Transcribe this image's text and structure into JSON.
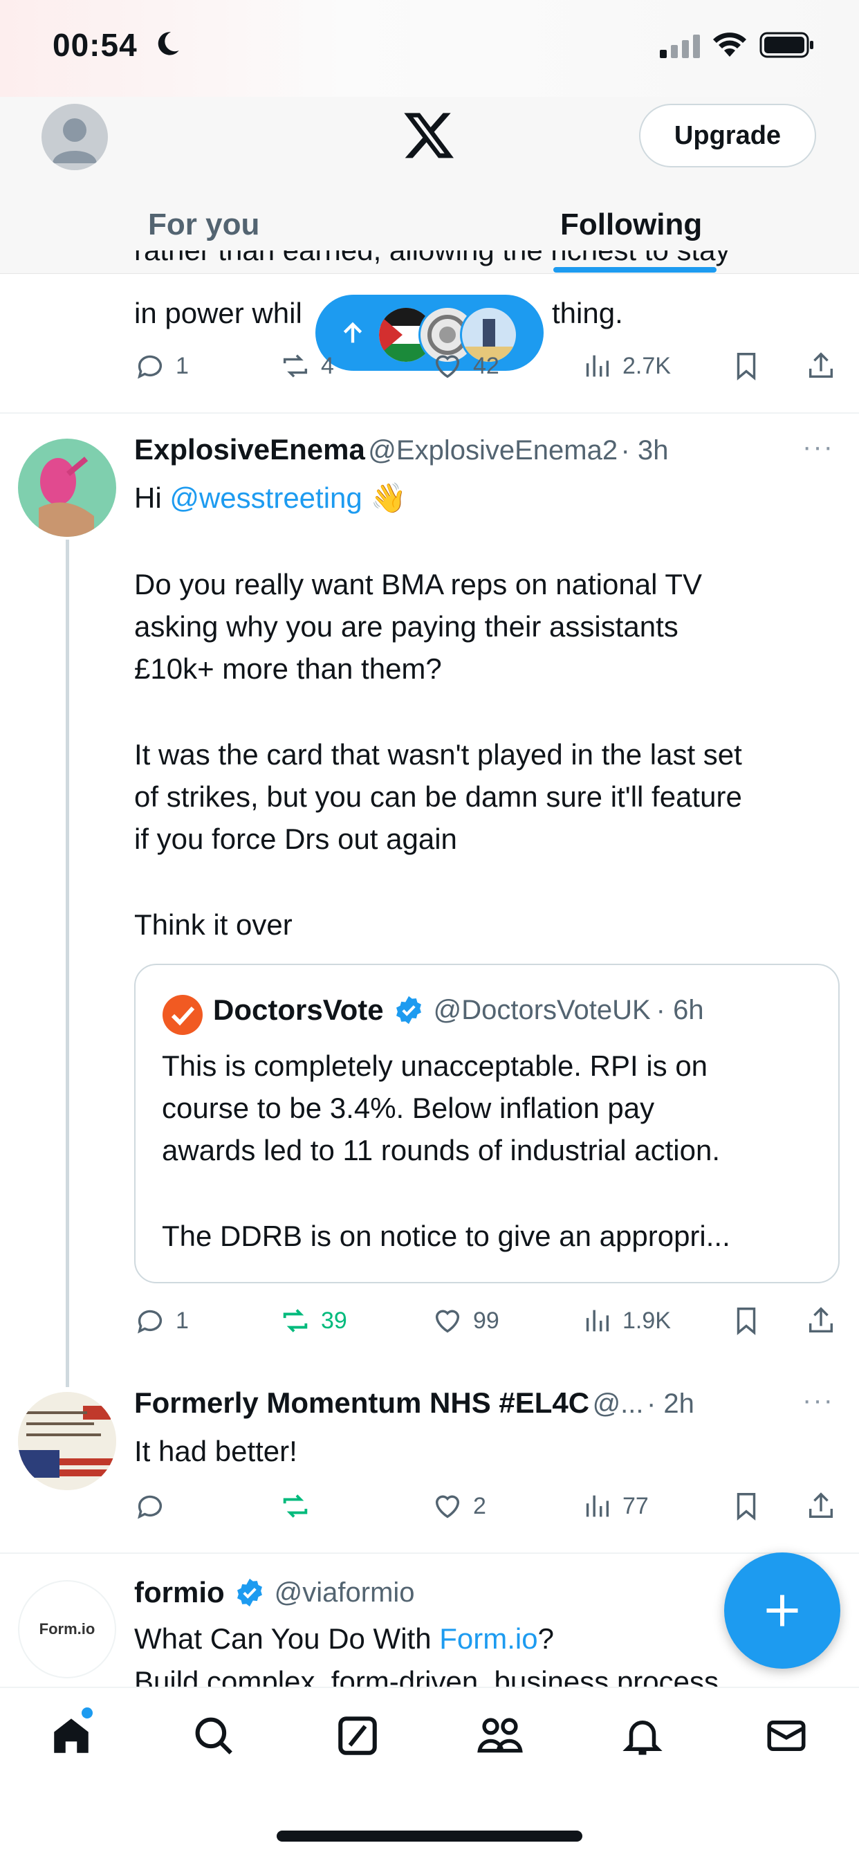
{
  "status_bar": {
    "time": "00:54",
    "moon_icon": "moon-icon",
    "signal": "signal-icon",
    "wifi": "wifi-icon",
    "battery": "battery-icon"
  },
  "header": {
    "logo": "X",
    "upgrade_label": "Upgrade"
  },
  "tabs": [
    {
      "label": "For you",
      "active": false
    },
    {
      "label": "Following",
      "active": true
    }
  ],
  "new_posts_pill": {
    "icon": "arrow-up-icon"
  },
  "partial_post": {
    "text_line_1": "rather than earned, allowing the richest to stay",
    "text_line_2": "in power whil",
    "text_line_2_end": "thing.",
    "actions": {
      "replies": "1",
      "reposts": "4",
      "likes": "42",
      "views": "2.7K"
    }
  },
  "post_1": {
    "name": "ExplosiveEnema",
    "handle": "@ExplosiveEnema2",
    "time": "· 3h",
    "text_hi": "Hi ",
    "mention": "@wesstreeting",
    "emoji": "👋",
    "para_1a": "Do you really want BMA reps on national TV",
    "para_1b": "asking why you are paying their assistants",
    "para_1c": "£10k+ more than them?",
    "para_2a": "It was the card that wasn't played in the last set",
    "para_2b": "of strikes, but you can be damn sure it'll feature",
    "para_2c": "if you force Drs out again",
    "para_3": "Think it over",
    "quote": {
      "name": "DoctorsVote",
      "handle": "@DoctorsVoteUK",
      "time": "· 6h",
      "line_1": "This is completely unacceptable. RPI is on",
      "line_2": "course to be 3.4%. Below inflation pay",
      "line_3": "awards led to 11 rounds of industrial action.",
      "line_4": "The DDRB is on notice to give an appropri..."
    },
    "actions": {
      "replies": "1",
      "reposts": "39",
      "likes": "99",
      "views": "1.9K"
    }
  },
  "post_2": {
    "name": "Formerly Momentum NHS #EL4C",
    "handle": "@...",
    "time": "· 2h",
    "text": "It had better!",
    "actions": {
      "replies": "",
      "reposts": "",
      "likes": "2",
      "views": "77"
    }
  },
  "post_3": {
    "name": "formio",
    "handle": "@viaformio",
    "text_a": "What Can You Do With ",
    "link": "Form.io",
    "text_b": "?",
    "text_c": "Build complex, form-driven, business process",
    "avatar_label": "Form.io"
  },
  "colors": {
    "accent": "#1d9bf0",
    "repost_green": "#00ba7c",
    "text": "#0f1419",
    "muted": "#536471"
  },
  "nav": [
    "home-icon",
    "search-icon",
    "grok-icon",
    "communities-icon",
    "notifications-icon",
    "messages-icon"
  ]
}
